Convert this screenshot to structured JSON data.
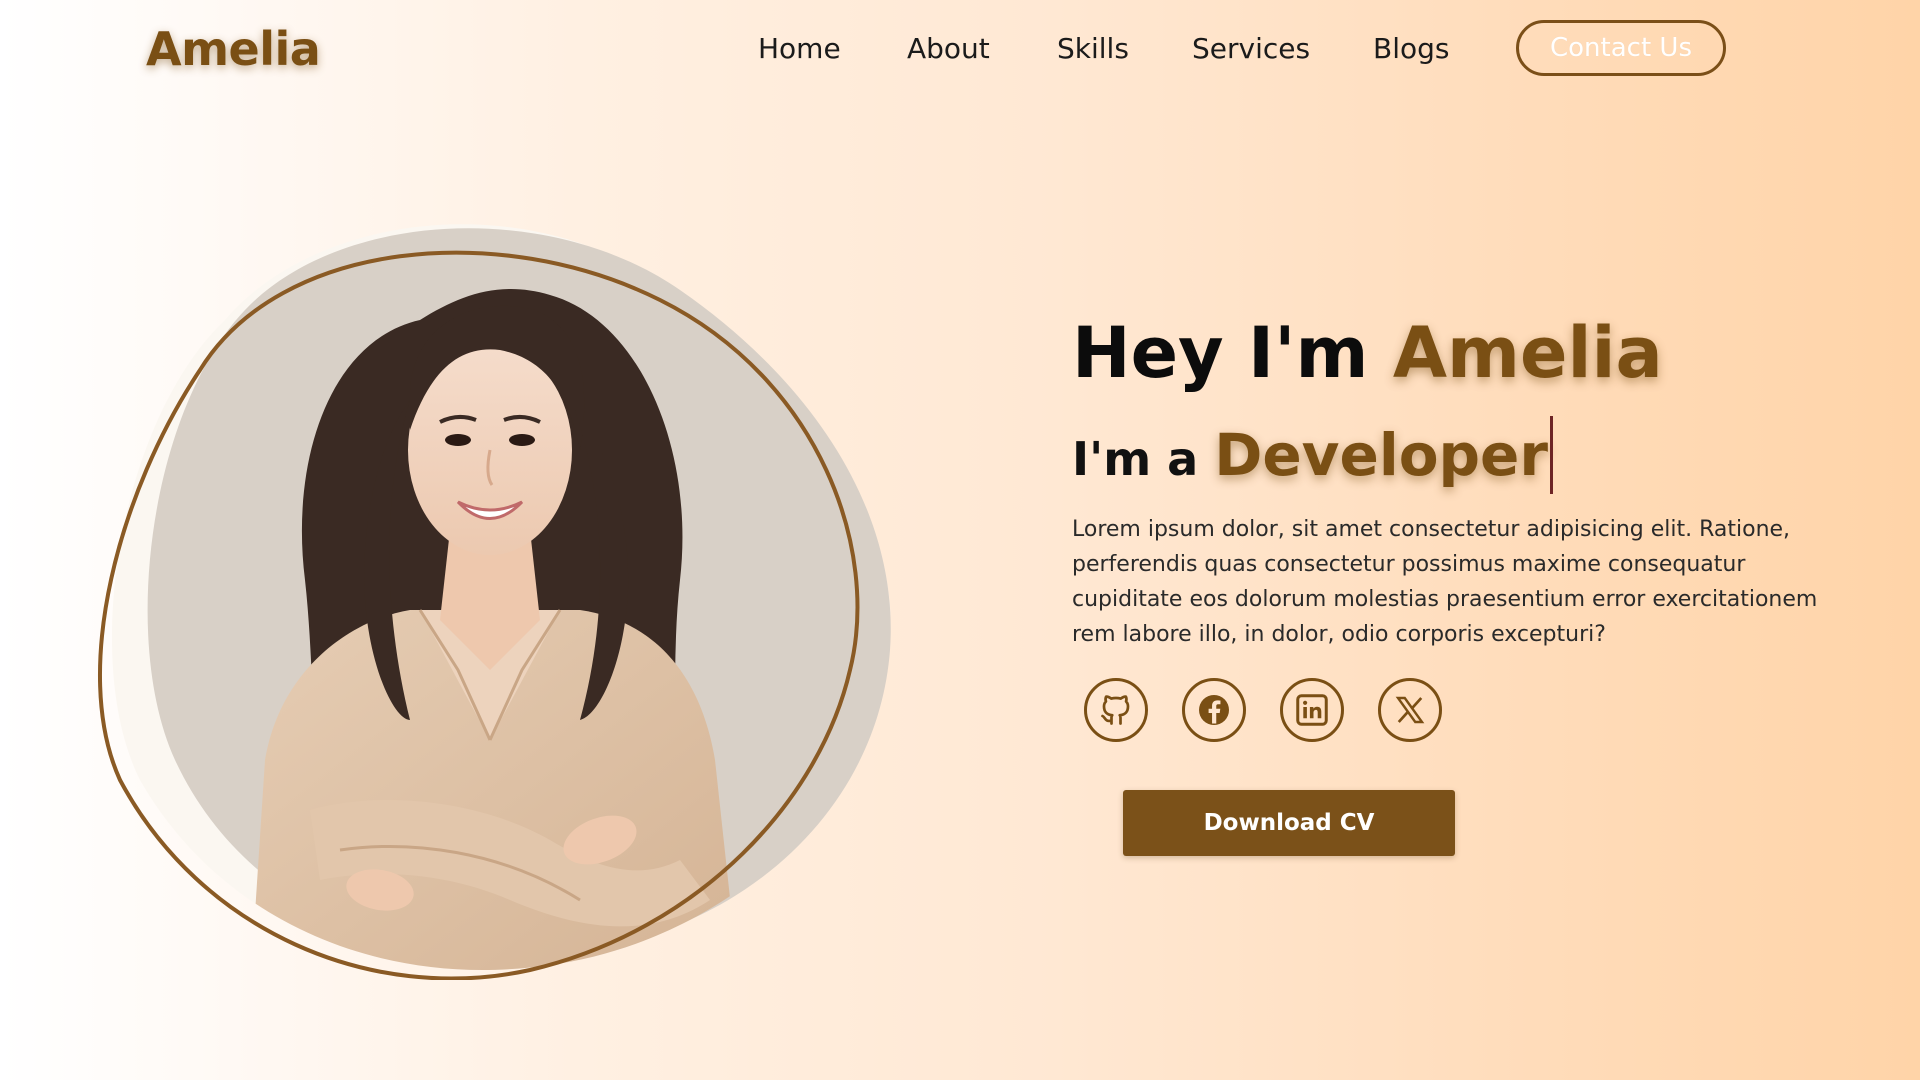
{
  "header": {
    "brand": "Amelia",
    "nav": [
      {
        "label": "Home"
      },
      {
        "label": "About"
      },
      {
        "label": "Skills"
      },
      {
        "label": "Services"
      },
      {
        "label": "Blogs"
      }
    ],
    "contact_label": "Contact Us"
  },
  "hero": {
    "greeting": "Hey I'm",
    "name": "Amelia",
    "role_prefix": "I'm a",
    "role": "Developer",
    "bio": "Lorem ipsum dolor, sit amet consectetur adipisicing elit. Ratione, perferendis quas consectetur possimus maxime consequatur cupiditate eos dolorum molestias praesentium error exercitationem rem labore illo, in dolor, odio corporis excepturi?",
    "socials": [
      {
        "icon": "github-icon"
      },
      {
        "icon": "facebook-icon"
      },
      {
        "icon": "linkedin-icon"
      },
      {
        "icon": "x-icon"
      }
    ],
    "download_label": "Download CV"
  },
  "colors": {
    "accent": "#7a4f14",
    "button": "#7b5119",
    "caret": "#6e2525"
  }
}
